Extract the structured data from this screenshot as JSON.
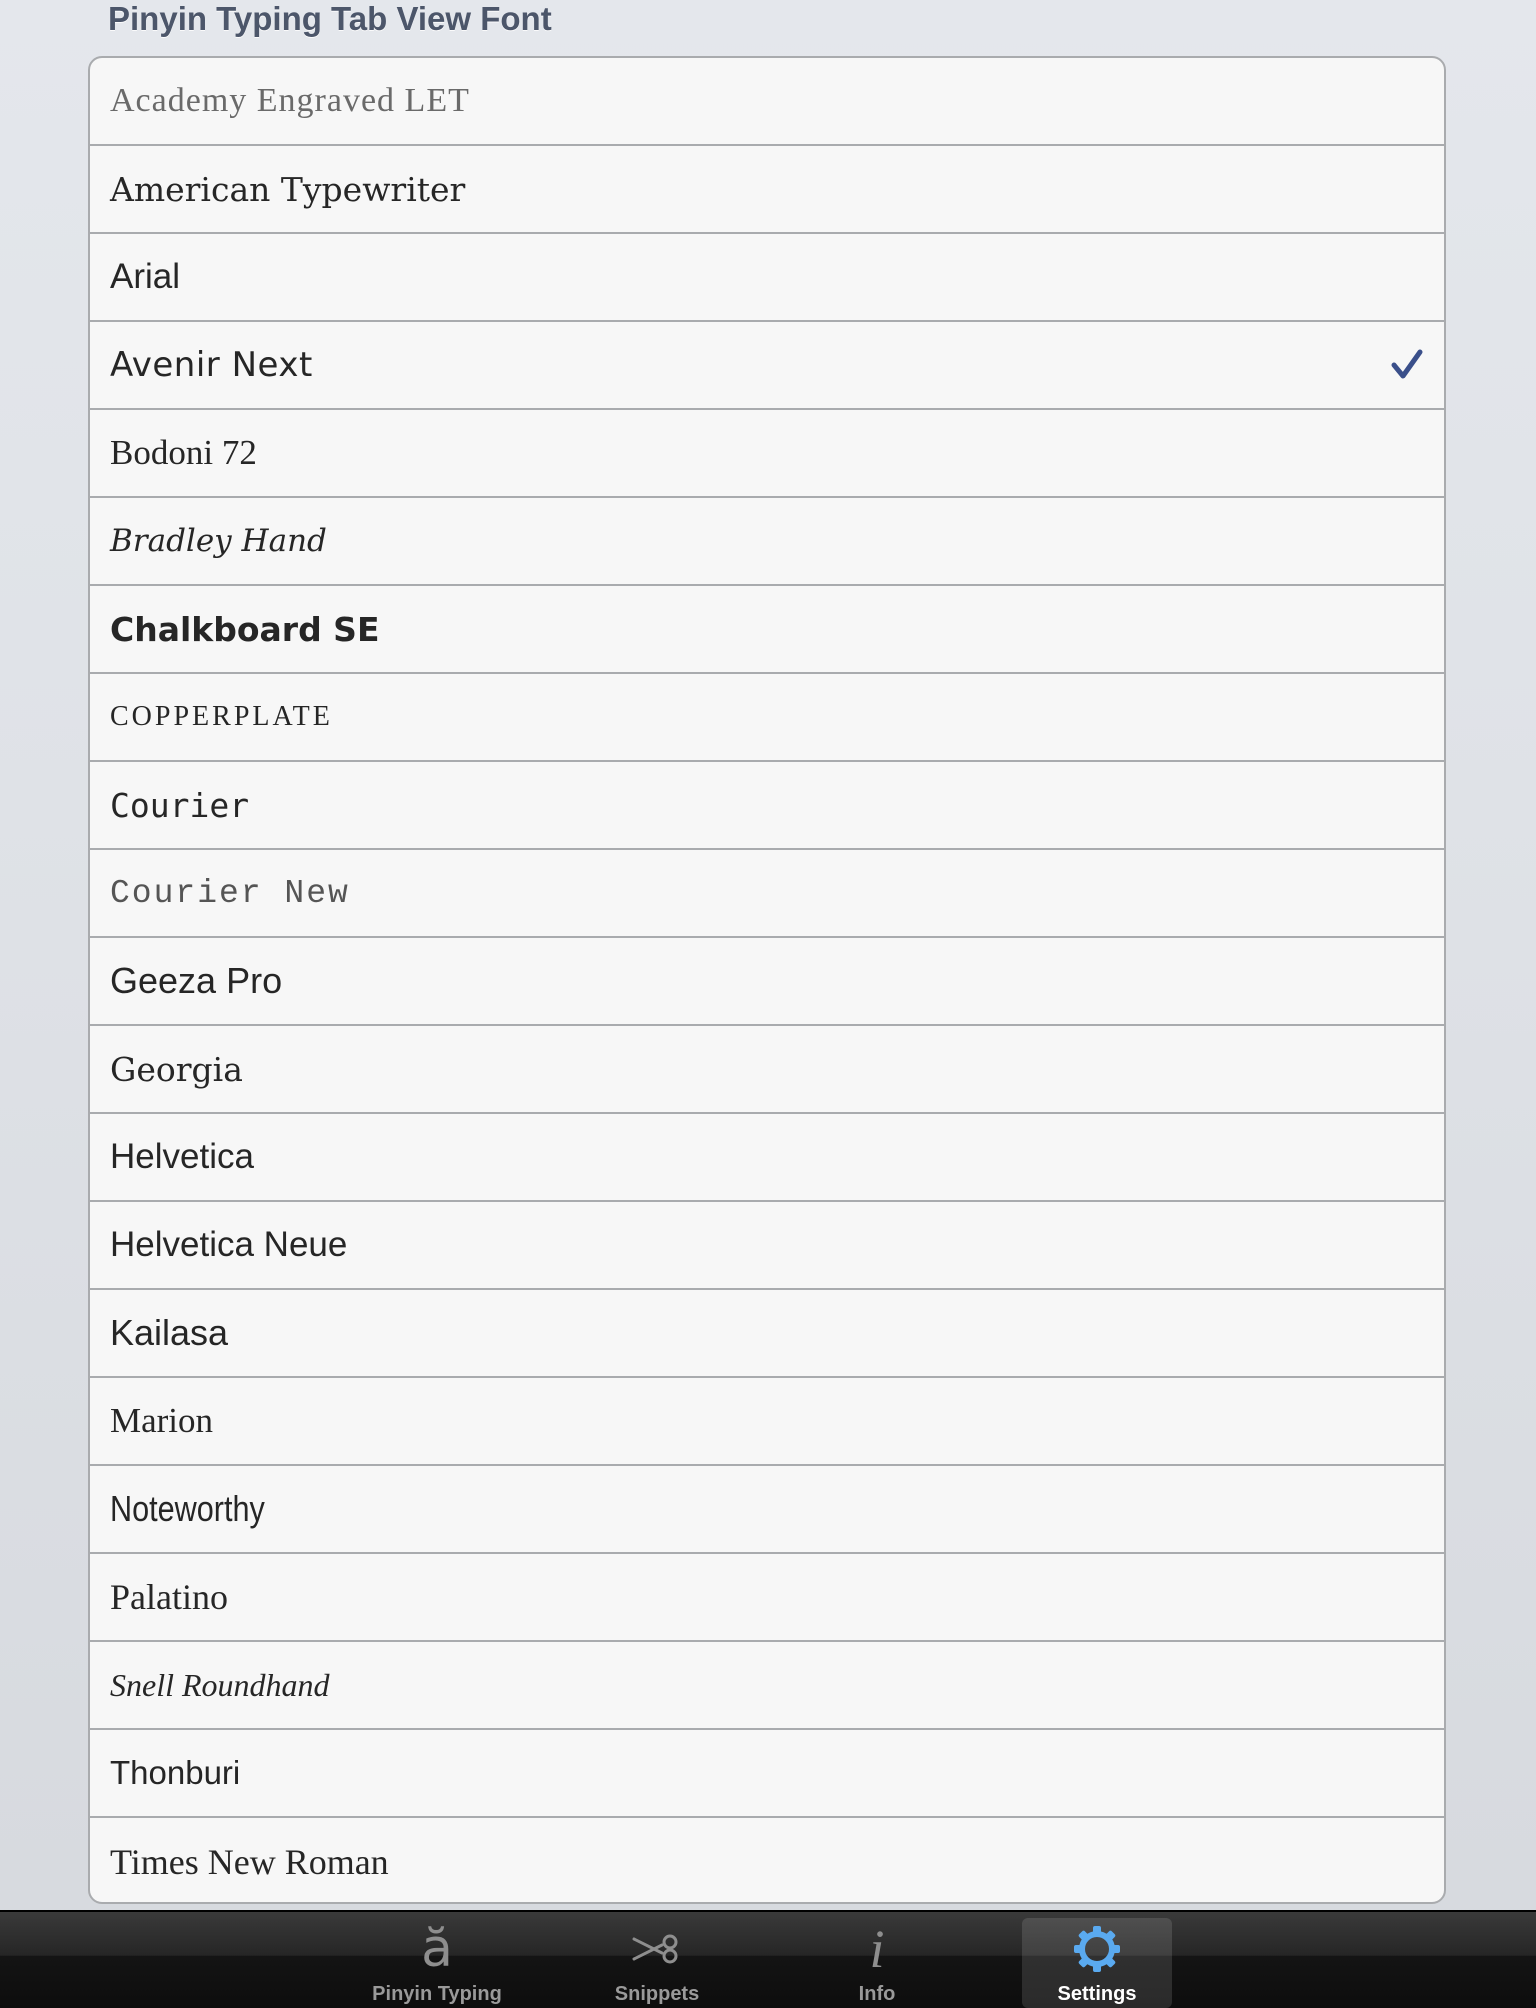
{
  "section": {
    "title": "Pinyin Typing Tab View Font"
  },
  "fonts": [
    {
      "label": "Academy Engraved LET"
    },
    {
      "label": "American Typewriter"
    },
    {
      "label": "Arial"
    },
    {
      "label": "Avenir Next",
      "selected": true
    },
    {
      "label": "Bodoni 72"
    },
    {
      "label": "Bradley Hand"
    },
    {
      "label": "Chalkboard SE"
    },
    {
      "label": "COPPERPLATE"
    },
    {
      "label": "Courier"
    },
    {
      "label": "Courier New"
    },
    {
      "label": "Geeza Pro"
    },
    {
      "label": "Georgia"
    },
    {
      "label": "Helvetica"
    },
    {
      "label": "Helvetica Neue"
    },
    {
      "label": "Kailasa"
    },
    {
      "label": "Marion"
    },
    {
      "label": "Noteworthy"
    },
    {
      "label": "Palatino"
    },
    {
      "label": "Snell Roundhand"
    },
    {
      "label": "Thonburi"
    },
    {
      "label": "Times New Roman"
    }
  ],
  "checkmark_icon": "checkmark-icon",
  "colors": {
    "checkmark": "#3a4f8a",
    "selected_tab_icon": "#5aaaf0",
    "tab_inactive": "#8e8e8e"
  },
  "tabbar": {
    "tabs": [
      {
        "label": "Pinyin Typing",
        "icon": "a-breve-icon",
        "glyph": "ă"
      },
      {
        "label": "Snippets",
        "icon": "scissors-icon"
      },
      {
        "label": "Info",
        "icon": "info-icon",
        "glyph": "i"
      },
      {
        "label": "Settings",
        "icon": "gear-icon",
        "selected": true
      }
    ]
  }
}
